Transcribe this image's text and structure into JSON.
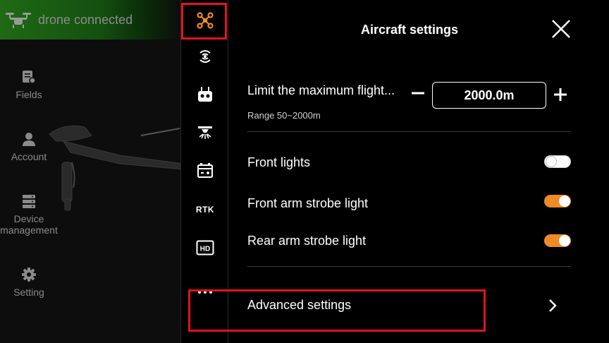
{
  "connection": {
    "status_text": "drone connected",
    "icon": "drone-icon"
  },
  "nav": {
    "items": [
      {
        "label": "Fields",
        "icon": "fields-icon"
      },
      {
        "label": "Account",
        "icon": "account-icon"
      },
      {
        "label": "Device management",
        "icon": "device-management-icon"
      },
      {
        "label": "Setting",
        "icon": "gear-icon"
      }
    ]
  },
  "rail": {
    "items": [
      {
        "icon": "aircraft-icon",
        "selected": true
      },
      {
        "icon": "signal-icon"
      },
      {
        "icon": "remote-controller-icon"
      },
      {
        "icon": "sprayer-icon"
      },
      {
        "icon": "battery-icon"
      },
      {
        "label": "RTK",
        "icon": "rtk-icon"
      },
      {
        "label": "HD",
        "icon": "hd-icon"
      },
      {
        "icon": "more-icon"
      }
    ]
  },
  "panel": {
    "title": "Aircraft settings",
    "limit": {
      "label": "Limit the maximum flight...",
      "value": "2000.0m",
      "range": "Range 50~2000m"
    },
    "toggles": [
      {
        "label": "Front lights",
        "on": false
      },
      {
        "label": "Front arm strobe light",
        "on": true
      },
      {
        "label": "Rear arm strobe light",
        "on": true
      }
    ],
    "advanced_label": "Advanced settings"
  },
  "colors": {
    "accent": "#f08a24",
    "highlight": "#e0141e",
    "connected_green": "#1f6a14"
  }
}
